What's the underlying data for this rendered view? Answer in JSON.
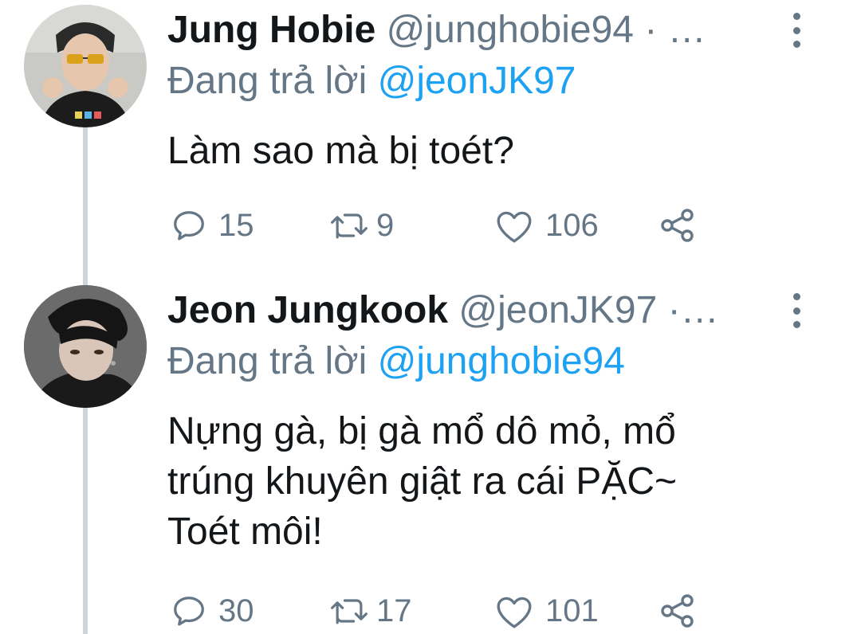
{
  "tweets": [
    {
      "name": "Jung Hobie",
      "handle": "@junghobie94",
      "separator": "· …",
      "reply_prefix": "Đang trả lời",
      "reply_to": "@jeonJK97",
      "lines": [
        "Làm sao mà bị toét?"
      ],
      "reply_count": "15",
      "retweet_count": "9",
      "like_count": "106"
    },
    {
      "name": "Jeon Jungkook",
      "handle": "@jeonJK97",
      "separator": "·…",
      "reply_prefix": "Đang trả lời",
      "reply_to": "@junghobie94",
      "lines": [
        "Nựng gà, bị gà mổ dô mỏ, mổ",
        "trúng khuyên giật ra cái PẶC~",
        "Toét môi!"
      ],
      "reply_count": "30",
      "retweet_count": "17",
      "like_count": "101"
    }
  ],
  "colors": {
    "text": "#14171a",
    "secondary": "#657786",
    "link": "#1da1f2",
    "thread_line": "#ccd6dd"
  },
  "icons": [
    "reply-icon",
    "retweet-icon",
    "like-icon",
    "share-icon",
    "more-options-icon"
  ]
}
